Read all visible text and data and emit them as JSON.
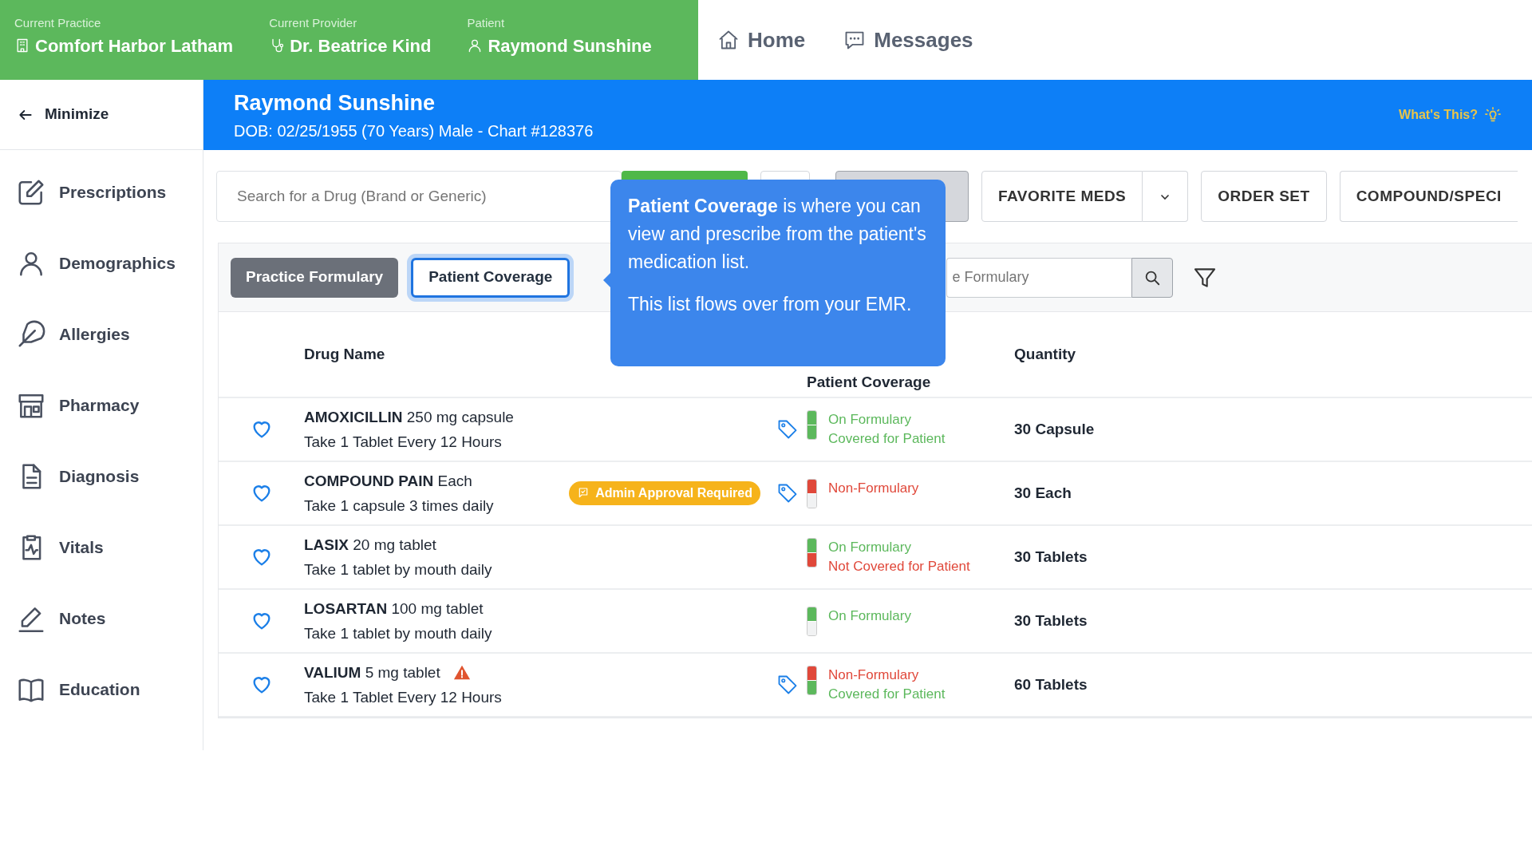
{
  "header": {
    "fields": [
      {
        "label": "Current Practice",
        "value": "Comfort Harbor Latham"
      },
      {
        "label": "Current Provider",
        "value": "Dr. Beatrice Kind"
      },
      {
        "label": "Patient",
        "value": "Raymond Sunshine"
      }
    ],
    "nav": [
      {
        "label": "Home"
      },
      {
        "label": "Messages"
      }
    ]
  },
  "sidebar": {
    "minimize": "Minimize",
    "items": [
      {
        "label": "Prescriptions"
      },
      {
        "label": "Demographics"
      },
      {
        "label": "Allergies"
      },
      {
        "label": "Pharmacy"
      },
      {
        "label": "Diagnosis"
      },
      {
        "label": "Vitals"
      },
      {
        "label": "Notes"
      },
      {
        "label": "Education"
      }
    ]
  },
  "banner": {
    "name": "Raymond Sunshine",
    "details": "DOB: 02/25/1955 (70 Years) Male - Chart #128376",
    "help": "What's This?"
  },
  "toolbar": {
    "search_placeholder": "Search for a Drug (Brand or Generic)",
    "buttons": [
      {
        "label": "FAVORITE MEDS",
        "dropdown": true
      },
      {
        "label": "ORDER SET",
        "dropdown": false
      },
      {
        "label": "COMPOUND/SPECI",
        "dropdown": false
      }
    ]
  },
  "tabs": [
    {
      "label": "Practice Formulary",
      "selected": false
    },
    {
      "label": "Patient Coverage",
      "selected": true
    }
  ],
  "formulary_search": {
    "placeholder": "e Formulary"
  },
  "table": {
    "columns": [
      "Drug Name",
      "Patient Coverage",
      "Quantity"
    ],
    "rows": [
      {
        "name": "**AMOXICILLIN** 250 mg capsule",
        "sig": "Take 1 Tablet Every 12 Hours",
        "warning": false,
        "tag": true,
        "on_formulary": true,
        "covered": true,
        "status": [
          "On Formulary",
          "Covered for Patient"
        ],
        "quantity": "30 Capsule"
      },
      {
        "name": "**COMPOUND PAIN** Each",
        "sig": "Take 1 capsule 3 times daily",
        "badge": "Admin Approval Required",
        "warning": false,
        "tag": true,
        "on_formulary": false,
        "status": [
          "Non-Formulary"
        ],
        "quantity": "30 Each"
      },
      {
        "name": "**LASIX** 20 mg tablet",
        "sig": "Take 1 tablet by mouth daily",
        "warning": false,
        "tag": false,
        "on_formulary": true,
        "covered": false,
        "status": [
          "On Formulary",
          "Not Covered for Patient"
        ],
        "quantity": "30 Tablets"
      },
      {
        "name": "**LOSARTAN** 100 mg tablet",
        "sig": "Take 1 tablet by mouth daily",
        "warning": false,
        "tag": false,
        "on_formulary": true,
        "status": [
          "On Formulary"
        ],
        "quantity": "30 Tablets"
      },
      {
        "name": "**VALIUM** 5 mg tablet",
        "sig": "Take 1 Tablet Every 12 Hours",
        "warning": true,
        "tag": true,
        "on_formulary": false,
        "covered": true,
        "status": [
          "Non-Formulary",
          "Covered for Patient"
        ],
        "quantity": "60 Tablets"
      }
    ]
  },
  "tooltip": {
    "paragraphs": [
      "**Patient Coverage** is where you can view and prescribe from the patient's medication list.",
      "This list flows over from your EMR."
    ]
  }
}
